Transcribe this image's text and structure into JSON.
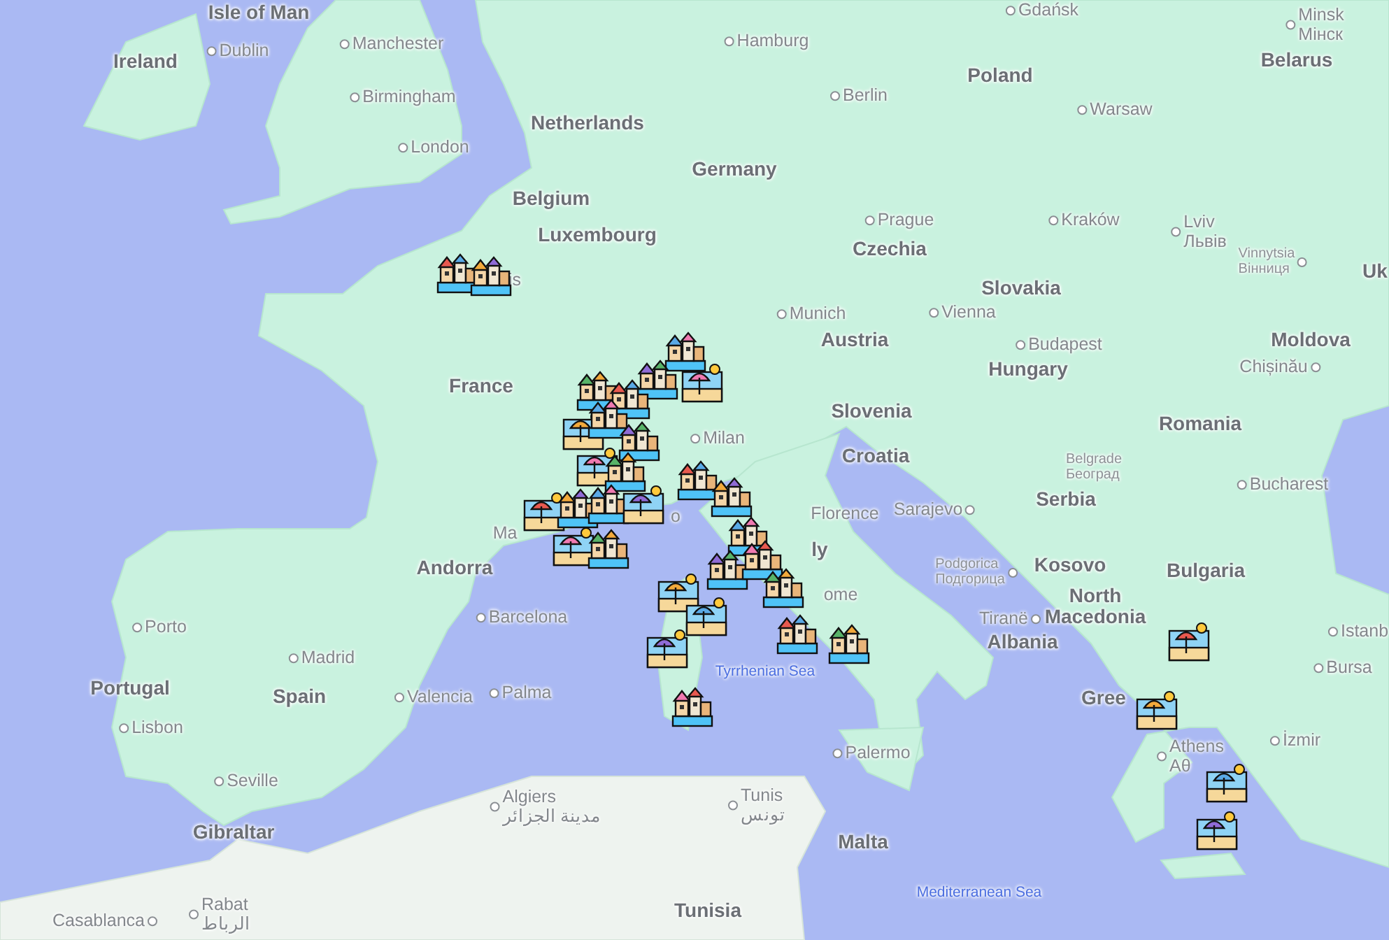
{
  "map": {
    "labels": [
      {
        "kind": "country",
        "text": "Isle of Man"
      },
      {
        "kind": "city",
        "text": "Gdańsk"
      },
      {
        "kind": "country",
        "text": "Ireland"
      },
      {
        "kind": "city",
        "text": "Dublin"
      },
      {
        "kind": "city",
        "text": "Manchester"
      },
      {
        "kind": "city",
        "text": "Hamburg"
      },
      {
        "kind": "city",
        "text": "Minsk",
        "native": "Мінск"
      },
      {
        "kind": "country",
        "text": "Poland"
      },
      {
        "kind": "country",
        "text": "Belarus"
      },
      {
        "kind": "city",
        "text": "Birmingham"
      },
      {
        "kind": "city",
        "text": "Berlin"
      },
      {
        "kind": "city",
        "text": "Warsaw"
      },
      {
        "kind": "country",
        "text": "Netherlands"
      },
      {
        "kind": "city",
        "text": "London"
      },
      {
        "kind": "country",
        "text": "Germany"
      },
      {
        "kind": "country",
        "text": "Belgium"
      },
      {
        "kind": "country",
        "text": "Luxembourg"
      },
      {
        "kind": "city",
        "text": "Prague"
      },
      {
        "kind": "city",
        "text": "Kraków"
      },
      {
        "kind": "country",
        "text": "Czechia"
      },
      {
        "kind": "city",
        "text": "Lviv",
        "native": "Львів"
      },
      {
        "kind": "city",
        "text": "is"
      },
      {
        "kind": "country",
        "text": "Slovakia"
      },
      {
        "kind": "town",
        "text": "Vinnytsia",
        "native": "Вінниця"
      },
      {
        "kind": "country",
        "text": "Uk"
      },
      {
        "kind": "city",
        "text": "Munich"
      },
      {
        "kind": "city",
        "text": "Vienna"
      },
      {
        "kind": "country",
        "text": "Austria"
      },
      {
        "kind": "city",
        "text": "Budapest"
      },
      {
        "kind": "country",
        "text": "Moldova"
      },
      {
        "kind": "country",
        "text": "France"
      },
      {
        "kind": "country",
        "text": "Hungary"
      },
      {
        "kind": "city",
        "text": "Chișinău"
      },
      {
        "kind": "country",
        "text": "Slovenia"
      },
      {
        "kind": "city",
        "text": "Milan"
      },
      {
        "kind": "country",
        "text": "Romania"
      },
      {
        "kind": "country",
        "text": "Croatia"
      },
      {
        "kind": "town",
        "text": "Belgrade",
        "native": "Београд"
      },
      {
        "kind": "city",
        "text": "Ma"
      },
      {
        "kind": "city",
        "text": "o"
      },
      {
        "kind": "city",
        "text": "Florence"
      },
      {
        "kind": "city",
        "text": "Sarajevo"
      },
      {
        "kind": "country",
        "text": "Serbia"
      },
      {
        "kind": "city",
        "text": "Bucharest"
      },
      {
        "kind": "country",
        "text": "Andorra"
      },
      {
        "kind": "country",
        "text": "ly"
      },
      {
        "kind": "town",
        "text": "Podgorica",
        "native": "Подгорица"
      },
      {
        "kind": "country",
        "text": "Kosovo"
      },
      {
        "kind": "country",
        "text": "Bulgaria"
      },
      {
        "kind": "city",
        "text": "Porto"
      },
      {
        "kind": "city",
        "text": "Barcelona"
      },
      {
        "kind": "city",
        "text": "ome"
      },
      {
        "kind": "city",
        "text": "Tiranë"
      },
      {
        "kind": "country",
        "text": "North Macedonia"
      },
      {
        "kind": "country",
        "text": "Albania"
      },
      {
        "kind": "city",
        "text": "Istanb"
      },
      {
        "kind": "city",
        "text": "Madrid"
      },
      {
        "kind": "country",
        "text": "Portugal"
      },
      {
        "kind": "country",
        "text": "Spain"
      },
      {
        "kind": "city",
        "text": "Valencia"
      },
      {
        "kind": "city",
        "text": "Palma"
      },
      {
        "kind": "sea",
        "text": "Tyrrhenian Sea"
      },
      {
        "kind": "country",
        "text": "Gree"
      },
      {
        "kind": "city",
        "text": "Bursa"
      },
      {
        "kind": "city",
        "text": "Lisbon"
      },
      {
        "kind": "city",
        "text": "Palermo"
      },
      {
        "kind": "city",
        "text": "Athens",
        "native": "Αθ"
      },
      {
        "kind": "city",
        "text": "İzmir"
      },
      {
        "kind": "city",
        "text": "Seville"
      },
      {
        "kind": "country",
        "text": "Gibraltar"
      },
      {
        "kind": "city",
        "text": "Algiers",
        "native": "مدينة الجزائر"
      },
      {
        "kind": "city",
        "text": "Tunis",
        "native": "تونس"
      },
      {
        "kind": "country",
        "text": "Malta"
      },
      {
        "kind": "city",
        "text": "Casablanca"
      },
      {
        "kind": "city",
        "text": "Rabat",
        "native": "الرباط"
      },
      {
        "kind": "country",
        "text": "Tunisia"
      },
      {
        "kind": "sea",
        "text": "Mediterranean Sea"
      }
    ],
    "markers": [
      {
        "kind": "town"
      },
      {
        "kind": "town"
      },
      {
        "kind": "town"
      },
      {
        "kind": "town"
      },
      {
        "kind": "beach"
      },
      {
        "kind": "town"
      },
      {
        "kind": "town"
      },
      {
        "kind": "beach"
      },
      {
        "kind": "town"
      },
      {
        "kind": "town"
      },
      {
        "kind": "beach"
      },
      {
        "kind": "town"
      },
      {
        "kind": "beach"
      },
      {
        "kind": "town"
      },
      {
        "kind": "town"
      },
      {
        "kind": "beach"
      },
      {
        "kind": "beach"
      },
      {
        "kind": "town"
      },
      {
        "kind": "town"
      },
      {
        "kind": "town"
      },
      {
        "kind": "town"
      },
      {
        "kind": "town"
      },
      {
        "kind": "town"
      },
      {
        "kind": "town"
      },
      {
        "kind": "town"
      },
      {
        "kind": "beach"
      },
      {
        "kind": "beach"
      },
      {
        "kind": "beach"
      },
      {
        "kind": "town"
      },
      {
        "kind": "town"
      },
      {
        "kind": "beach"
      },
      {
        "kind": "beach"
      },
      {
        "kind": "beach"
      },
      {
        "kind": "beach"
      }
    ]
  }
}
